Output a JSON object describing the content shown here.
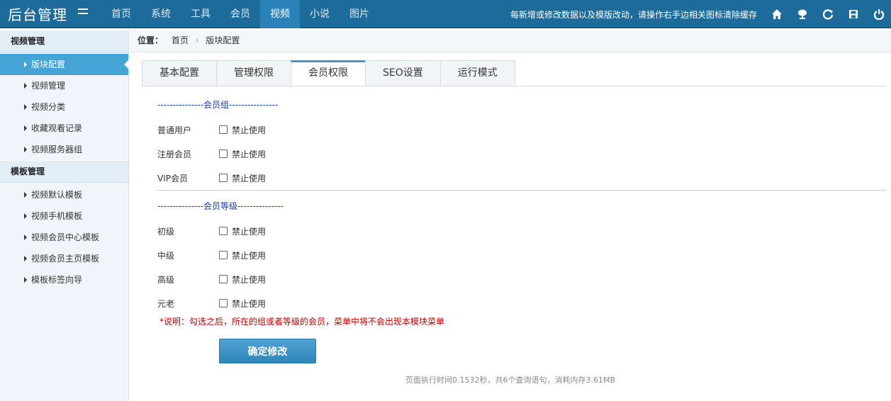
{
  "app": {
    "title": "后台管理"
  },
  "nav": [
    "首页",
    "系统",
    "工具",
    "会员",
    "视频",
    "小说",
    "图片"
  ],
  "top_notice": "每新增或修改数据以及模版改动，请操作右手边相关图标清除缓存",
  "sidebar": {
    "groups": [
      {
        "title": "视频管理",
        "items": [
          "版块配置",
          "视频管理",
          "视频分类",
          "收藏观看记录",
          "视频服务器组"
        ]
      },
      {
        "title": "模板管理",
        "items": [
          "视频默认模板",
          "视频手机模板",
          "视频会员中心模板",
          "视频会员主页模板",
          "模板标签向导"
        ]
      }
    ]
  },
  "breadcrumb": {
    "label": "位置：",
    "home": "首页",
    "current": "版块配置"
  },
  "tabs": [
    "基本配置",
    "管理权限",
    "会员权限",
    "SEO设置",
    "运行模式"
  ],
  "member_groups": {
    "heading": "---------------会员组----------------",
    "rows": [
      {
        "label": "普通用户",
        "option": "禁止使用"
      },
      {
        "label": "注册会员",
        "option": "禁止使用"
      },
      {
        "label": "VIP会员",
        "option": "禁止使用"
      }
    ]
  },
  "member_levels": {
    "heading": "---------------会员等级---------------",
    "rows": [
      {
        "label": "初级",
        "option": "禁止使用"
      },
      {
        "label": "中级",
        "option": "禁止使用"
      },
      {
        "label": "高级",
        "option": "禁止使用"
      },
      {
        "label": "元老",
        "option": "禁止使用"
      }
    ]
  },
  "note": "*说明：勾选之后，所在的组或者等级的会员，菜单中将不会出现本模块菜单",
  "submit_label": "确定修改",
  "footer": "页面执行时间0.1532秒，共6个查询语句，消耗内存3.61MB",
  "colors": {
    "topbar": "#1c6b9b",
    "active_nav": "#2a82b8",
    "active_side": "#44a4d6",
    "heading": "#1a3ea8",
    "note": "#c40000"
  }
}
